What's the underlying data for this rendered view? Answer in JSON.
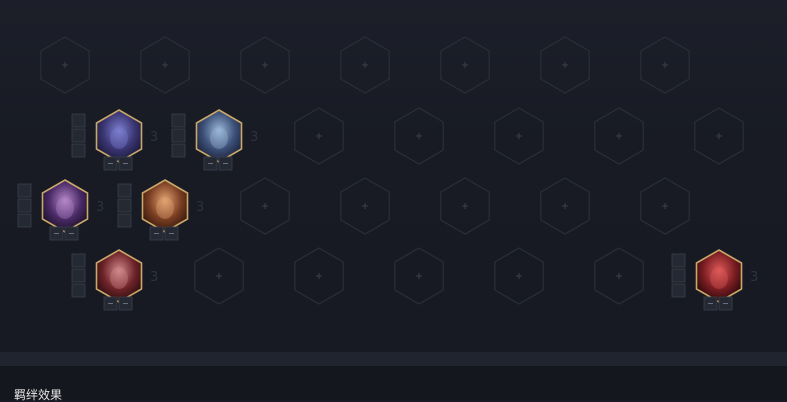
{
  "board": {
    "slot_icon": "plus-icon",
    "colors": {
      "slot_stroke": "#2a2e38",
      "plus": "#3a3f4b",
      "gold_frame": "#c9a86a",
      "control_box": "#252933",
      "control_border": "#3a3f4a",
      "star_text": "#2d3240",
      "background": "#181b24"
    },
    "rows": [
      [
        {
          "slot": "empty"
        },
        {
          "slot": "empty"
        },
        {
          "slot": "empty"
        },
        {
          "slot": "empty"
        },
        {
          "slot": "empty"
        },
        {
          "slot": "empty"
        },
        {
          "slot": "empty"
        }
      ],
      [
        {
          "slot": "champion",
          "portrait": "hooded-purple",
          "level": "3"
        },
        {
          "slot": "champion",
          "portrait": "blue-hair",
          "level": "3"
        },
        {
          "slot": "empty"
        },
        {
          "slot": "empty"
        },
        {
          "slot": "empty"
        },
        {
          "slot": "empty"
        },
        {
          "slot": "empty"
        }
      ],
      [
        {
          "slot": "champion",
          "portrait": "masked-dark",
          "level": "3"
        },
        {
          "slot": "champion",
          "portrait": "warrior-tan",
          "level": "3"
        },
        {
          "slot": "empty"
        },
        {
          "slot": "empty"
        },
        {
          "slot": "empty"
        },
        {
          "slot": "empty"
        },
        {
          "slot": "empty"
        }
      ],
      [
        {
          "slot": "champion",
          "portrait": "red-hair",
          "level": "3"
        },
        {
          "slot": "empty"
        },
        {
          "slot": "empty"
        },
        {
          "slot": "empty"
        },
        {
          "slot": "empty"
        },
        {
          "slot": "empty"
        },
        {
          "slot": "champion",
          "portrait": "crimson-beast",
          "level": "3"
        }
      ]
    ]
  },
  "footer": {
    "title": "羁绊效果"
  }
}
